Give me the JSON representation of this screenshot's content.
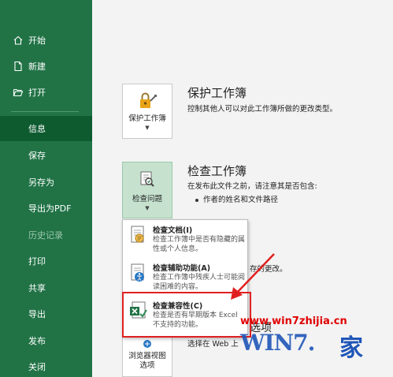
{
  "sidebar": {
    "items": [
      {
        "label": "开始",
        "icon": "home-icon"
      },
      {
        "label": "新建",
        "icon": "new-document-icon"
      },
      {
        "label": "打开",
        "icon": "open-folder-icon"
      },
      {
        "label": "信息",
        "selected": true
      },
      {
        "label": "保存"
      },
      {
        "label": "另存为"
      },
      {
        "label": "导出为PDF"
      },
      {
        "label": "历史记录",
        "disabled": true
      },
      {
        "label": "打印"
      },
      {
        "label": "共享"
      },
      {
        "label": "导出"
      },
      {
        "label": "发布"
      },
      {
        "label": "关闭"
      }
    ]
  },
  "protect": {
    "tile_label": "保护工作簿",
    "title": "保护工作簿",
    "desc": "控制其他人可以对此工作簿所做的更改类型。"
  },
  "inspect": {
    "tile_label": "检查问题",
    "title": "检查工作簿",
    "desc": "在发布此文件之前，请注意其是否包含:",
    "bullet": "作者的姓名和文件路径"
  },
  "dropdown": {
    "items": [
      {
        "title": "检查文档(I)",
        "desc": "检查工作簿中是否有隐藏的属性或个人信息。",
        "icon": "inspect-document-icon"
      },
      {
        "title": "检查辅助功能(A)",
        "desc": "检查工作簿中残疾人士可能阅读困难的内容。",
        "icon": "accessibility-icon"
      },
      {
        "title": "检查兼容性(C)",
        "desc": "检查是否有早期版本 Excel 不支持的功能。",
        "icon": "compatibility-icon"
      }
    ]
  },
  "partial": {
    "manage_tail": "存的更改。",
    "options_tail": "选项",
    "browser_line": "选择在 Web 上"
  },
  "browser_tile": {
    "label_line1": "浏览器视图",
    "label_line2": "选项"
  },
  "watermark": {
    "url": "www.win7zhijia.cn",
    "logo": "WIN7.",
    "char": "家"
  },
  "colors": {
    "sidebar_bg": "#217346",
    "sidebar_selected": "#0e5b30",
    "highlight": "#e02020"
  }
}
